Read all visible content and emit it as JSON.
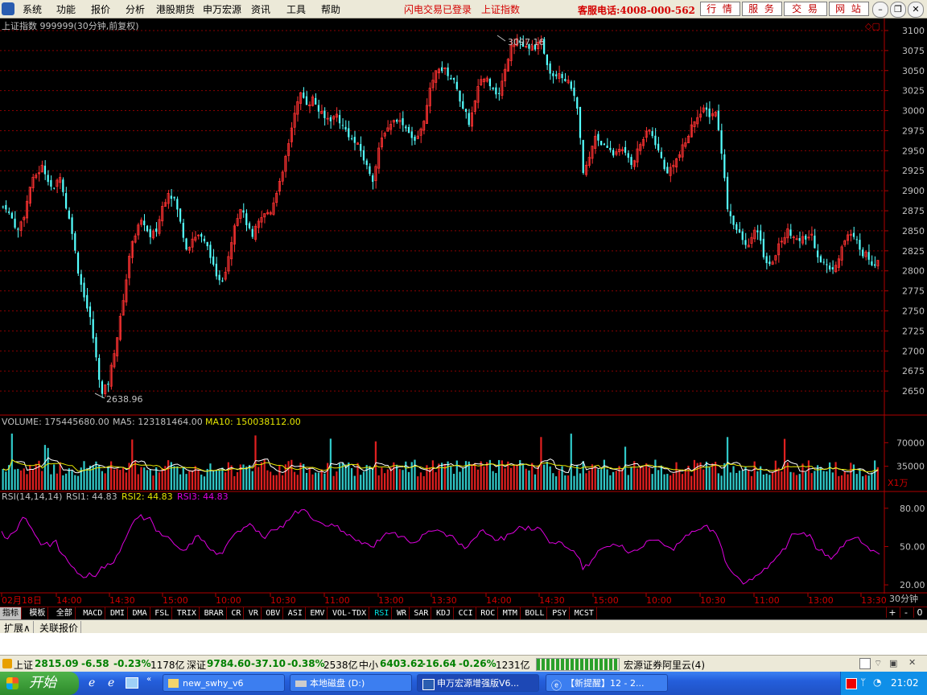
{
  "menubar": {
    "items": [
      "系统",
      "功能",
      "报价",
      "分析",
      "港股期货",
      "申万宏源",
      "资讯",
      "工具",
      "帮助"
    ],
    "status_login": "闪电交易已登录",
    "status_index": "上证指数",
    "hotline": "客服电话:4008-000-562",
    "buttons": [
      "行 情",
      "服 务",
      "交 易",
      "网 站"
    ]
  },
  "chart_header": {
    "title": "上证指数 999999(30分钟,前复权)",
    "high_label": "3097.16",
    "low_label": "2638.96"
  },
  "volume_header": {
    "volume": "VOLUME: 175445680.00",
    "ma5": "MA5: 123181464.00",
    "ma10": "MA10: 150038112.00",
    "unit": "X1万",
    "ticks": [
      "70000",
      "35000"
    ]
  },
  "rsi_header": {
    "name": "RSI(14,14,14)",
    "rsi1": "RSI1: 44.83",
    "rsi2": "RSI2: 44.83",
    "rsi3": "RSI3: 44.83",
    "ticks": [
      "80.00",
      "50.00",
      "20.00"
    ]
  },
  "time_axis": {
    "labels": [
      "02月18日",
      "14:00",
      "14:30",
      "15:00",
      "10:00",
      "10:30",
      "11:00",
      "13:00",
      "13:30",
      "14:00",
      "14:30",
      "15:00",
      "10:00",
      "10:30",
      "11:00",
      "13:00",
      "13:30"
    ],
    "period": "30分钟"
  },
  "indicator_tabs": [
    "指标",
    "模板",
    "全部",
    "MACD",
    "DMI",
    "DMA",
    "FSL",
    "TRIX",
    "BRAR",
    "CR",
    "VR",
    "OBV",
    "ASI",
    "EMV",
    "VOL-TDX",
    "RSI",
    "WR",
    "SAR",
    "KDJ",
    "CCI",
    "ROC",
    "MTM",
    "BOLL",
    "PSY",
    "MCST"
  ],
  "indicator_controls": [
    "+",
    "-",
    "0"
  ],
  "sub_tabs": [
    "扩展∧",
    "关联报价"
  ],
  "statusbar": {
    "sh_name": "上证",
    "sh_price": "2815.09",
    "sh_change": "-6.58",
    "sh_pct": "-0.23%",
    "sh_amount": "1178亿",
    "sz_name": "深证",
    "sz_price": "9784.60",
    "sz_change": "-37.10",
    "sz_pct": "-0.38%",
    "sz_amount": "2538亿",
    "zx_name": "中小",
    "zx_price": "6403.62",
    "zx_change": "-16.64",
    "zx_pct": "-0.26%",
    "zx_amount": "1231亿",
    "broker": "宏源证券阿里云(4)"
  },
  "taskbar": {
    "start": "开始",
    "items": [
      "new_swhy_v6",
      "本地磁盘 (D:)",
      "申万宏源增强版V6...",
      "【新提醒】12 - 2..."
    ],
    "clock": "21:02"
  },
  "chart_data": {
    "type": "candlestick",
    "price_axis": {
      "min": 2625,
      "max": 3110,
      "ticks": [
        3100,
        3075,
        3050,
        3025,
        3000,
        2975,
        2950,
        2925,
        2900,
        2875,
        2850,
        2825,
        2800,
        2775,
        2750,
        2725,
        2700,
        2675,
        2650
      ]
    },
    "high": 3097.16,
    "low": 2638.96,
    "close_series": [
      2880,
      2865,
      2850,
      2870,
      2905,
      2920,
      2930,
      2915,
      2900,
      2920,
      2880,
      2850,
      2800,
      2770,
      2740,
      2690,
      2645,
      2660,
      2700,
      2740,
      2790,
      2840,
      2855,
      2860,
      2840,
      2850,
      2880,
      2900,
      2890,
      2860,
      2830,
      2840,
      2845,
      2835,
      2820,
      2790,
      2790,
      2820,
      2860,
      2880,
      2860,
      2840,
      2860,
      2870,
      2875,
      2900,
      2920,
      2960,
      3000,
      3020,
      3010,
      3015,
      3000,
      2990,
      2990,
      2995,
      2980,
      2970,
      2960,
      2950,
      2930,
      2915,
      2950,
      2975,
      2985,
      2990,
      2985,
      2975,
      2960,
      2975,
      3005,
      3040,
      3055,
      3050,
      3040,
      3030,
      3000,
      2985,
      3010,
      3040,
      3040,
      3030,
      3020,
      3050,
      3085,
      3090,
      3080,
      3075,
      3080,
      3085,
      3060,
      3045,
      3050,
      3040,
      3030,
      3000,
      2920,
      2940,
      2970,
      2960,
      2950,
      2945,
      2955,
      2945,
      2935,
      2950,
      2965,
      2975,
      2960,
      2940,
      2920,
      2935,
      2945,
      2960,
      2980,
      2995,
      3000,
      2995,
      3000,
      2950,
      2880,
      2860,
      2845,
      2830,
      2840,
      2850,
      2820,
      2805,
      2820,
      2840,
      2850,
      2845,
      2835,
      2840,
      2845,
      2820,
      2810,
      2800,
      2810,
      2830,
      2845,
      2840,
      2830,
      2820,
      2810,
      2815
    ],
    "volume_axis": {
      "min": 0,
      "max": 105000,
      "ticks": [
        70000,
        35000
      ]
    },
    "rsi_axis": {
      "min": 15,
      "max": 90,
      "ticks": [
        80,
        50,
        20
      ]
    },
    "rsi_series": [
      62,
      56,
      61,
      69,
      72,
      64,
      56,
      52,
      50,
      55,
      44,
      38,
      33,
      28,
      26,
      27,
      30,
      33,
      36,
      43,
      52,
      62,
      71,
      75,
      72,
      68,
      62,
      58,
      55,
      50,
      47,
      52,
      58,
      55,
      50,
      47,
      45,
      50,
      57,
      62,
      65,
      68,
      62,
      58,
      60,
      63,
      66,
      70,
      74,
      76,
      79,
      73,
      70,
      68,
      66,
      66,
      62,
      59,
      57,
      55,
      53,
      50,
      55,
      58,
      60,
      61,
      58,
      55,
      53,
      55,
      60,
      62,
      63,
      61,
      59,
      55,
      52,
      50,
      56,
      62,
      60,
      58,
      55,
      55,
      60,
      63,
      65,
      66,
      63,
      64,
      57,
      53,
      54,
      50,
      47,
      43,
      32,
      35,
      42,
      48,
      50,
      52,
      50,
      47,
      46,
      47,
      50,
      55,
      55,
      53,
      50,
      47,
      53,
      59,
      62,
      63,
      66,
      62,
      60,
      48,
      34,
      28,
      24,
      22,
      24,
      28,
      33,
      37,
      42,
      48,
      54,
      60,
      60,
      58,
      55,
      47,
      43,
      40,
      45,
      50,
      55,
      57,
      53,
      50,
      47,
      44
    ]
  }
}
